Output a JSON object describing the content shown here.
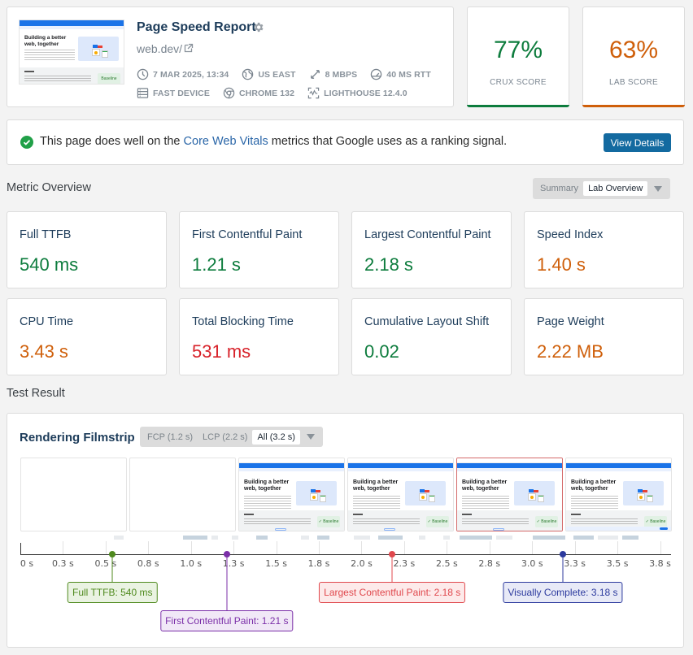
{
  "header": {
    "title": "Page Speed Report",
    "url": "web.dev/",
    "thumbnail": {
      "heading_line1": "Building a better",
      "heading_line2": "web, together",
      "footer_badge": "Baseline"
    },
    "meta_row_1": [
      {
        "icon": "clock-icon",
        "label": "7 MAR 2025, 13:34"
      },
      {
        "icon": "globe-icon",
        "label": "US EAST"
      },
      {
        "icon": "bandwidth-icon",
        "label": "8 MBPS"
      },
      {
        "icon": "gauge-icon",
        "label": "40 MS RTT"
      }
    ],
    "meta_row_2": [
      {
        "icon": "server-icon",
        "label": "FAST DEVICE"
      },
      {
        "icon": "chrome-icon",
        "label": "CHROME 132"
      },
      {
        "icon": "lighthouse-icon",
        "label": "LIGHTHOUSE 12.4.0"
      }
    ]
  },
  "scores": {
    "crux": {
      "value": "77%",
      "label": "CRUX SCORE",
      "color": "#0d7c3d"
    },
    "lab": {
      "value": "63%",
      "label": "LAB SCORE",
      "color": "#cf5f0a"
    }
  },
  "cwv_banner": {
    "text_before": "This page does well on the ",
    "link": "Core Web Vitals",
    "text_after": " metrics that Google uses as a ranking signal.",
    "button": "View Details"
  },
  "metric_overview": {
    "title": "Metric Overview",
    "views": [
      "Summary",
      "Lab Overview"
    ],
    "active_view": "Lab Overview",
    "metrics": [
      {
        "label": "Full TTFB",
        "value": "540 ms",
        "status": "good"
      },
      {
        "label": "First Contentful Paint",
        "value": "1.21 s",
        "status": "good"
      },
      {
        "label": "Largest Contentful Paint",
        "value": "2.18 s",
        "status": "good"
      },
      {
        "label": "Speed Index",
        "value": "1.40 s",
        "status": "average"
      },
      {
        "label": "CPU Time",
        "value": "3.43 s",
        "status": "average"
      },
      {
        "label": "Total Blocking Time",
        "value": "531 ms",
        "status": "poor"
      },
      {
        "label": "Cumulative Layout Shift",
        "value": "0.02",
        "status": "good"
      },
      {
        "label": "Page Weight",
        "value": "2.22 MB",
        "status": "average"
      }
    ]
  },
  "status_colors": {
    "good": "#0d7c3d",
    "average": "#cf5f0a",
    "poor": "#d8222a"
  },
  "test_result": {
    "title": "Test Result",
    "filmstrip": {
      "title": "Rendering Filmstrip",
      "ranges": [
        "FCP (1.2 s)",
        "LCP (2.2 s)",
        "All (3.2 s)"
      ],
      "active_range": "All (3.2 s)",
      "frames": [
        {
          "state": "blank"
        },
        {
          "state": "blank"
        },
        {
          "state": "rendered"
        },
        {
          "state": "rendered"
        },
        {
          "state": "rendered",
          "highlight": true
        },
        {
          "state": "rendered",
          "cookie_bar": true
        }
      ],
      "axis_max_s": 3.8,
      "tick_labels": [
        "0 s",
        "0.3 s",
        "0.5 s",
        "0.8 s",
        "1.0 s",
        "1.3 s",
        "1.5 s",
        "1.8 s",
        "2.0 s",
        "2.3 s",
        "2.5 s",
        "2.8 s",
        "3.0 s",
        "3.3 s",
        "3.5 s",
        "3.8 s"
      ],
      "tick_values": [
        0,
        0.25,
        0.5,
        0.75,
        1.0,
        1.25,
        1.5,
        1.75,
        2.0,
        2.25,
        2.5,
        2.75,
        3.0,
        3.25,
        3.5,
        3.75
      ],
      "markers": [
        {
          "label": "Full TTFB: 540 ms",
          "time_s": 0.54,
          "color": "#4f8a1e",
          "bg": "#eaf3e2",
          "row": 0
        },
        {
          "label": "First Contentful Paint: 1.21 s",
          "time_s": 1.21,
          "color": "#7b2fa8",
          "bg": "#f1e8f7",
          "row": 1
        },
        {
          "label": "Largest Contentful Paint: 2.18 s",
          "time_s": 2.18,
          "color": "#e0484d",
          "bg": "#fdeaea",
          "row": 0
        },
        {
          "label": "Visually Complete: 3.18 s",
          "time_s": 3.18,
          "color": "#2c3a9e",
          "bg": "#e8eaf7",
          "row": 0
        }
      ]
    }
  }
}
